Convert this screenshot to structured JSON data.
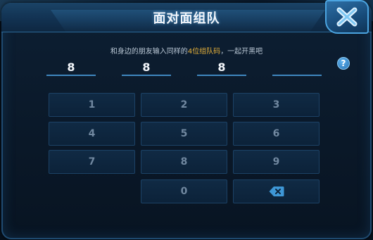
{
  "dialog": {
    "title": "面对面组队",
    "hint_before": "和身边的朋友输入同样的",
    "hint_highlight": "4位组队码",
    "hint_after": "，一起开黑吧",
    "help_label": "?"
  },
  "code": [
    "8",
    "8",
    "8",
    ""
  ],
  "keypad": {
    "keys": [
      "1",
      "2",
      "3",
      "4",
      "5",
      "6",
      "7",
      "8",
      "9",
      "0"
    ],
    "delete_icon": "backspace-icon"
  },
  "icons": {
    "close": "close-icon",
    "help": "help-icon"
  },
  "colors": {
    "highlight": "#e8b23a",
    "accent": "#3f87bf",
    "key_text": "#7188a0"
  }
}
